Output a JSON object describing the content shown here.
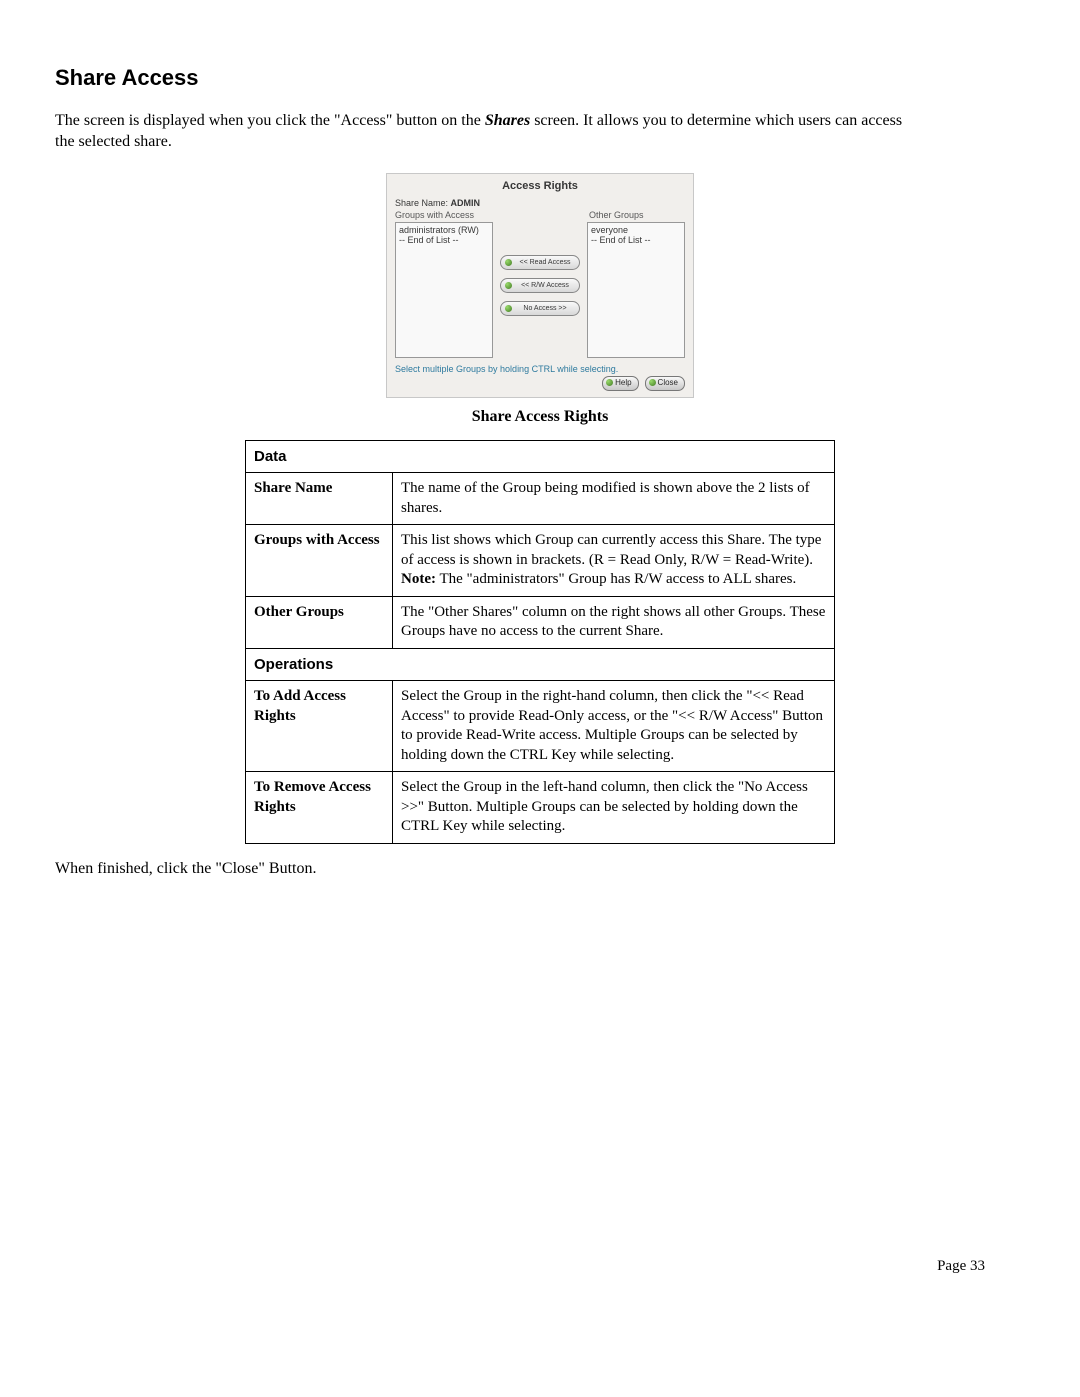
{
  "heading": "Share Access",
  "intro_a": "The screen is displayed when you click the \"Access\" button on the ",
  "intro_b": "Shares",
  "intro_c": " screen. It allows you to determine which users can access the selected share.",
  "dialog": {
    "title": "Access Rights",
    "share_label": "Share Name:",
    "share_value": "ADMIN",
    "left_label": "Groups with Access",
    "right_label": "Other Groups",
    "left_items": [
      "administrators (RW)",
      "-- End of List --"
    ],
    "right_items": [
      "everyone",
      "-- End of List --"
    ],
    "btn_read": "<< Read Access",
    "btn_rw": "<< R/W Access",
    "btn_none": "No Access >>",
    "hint": "Select multiple Groups by holding CTRL while selecting.",
    "btn_help": "Help",
    "btn_close": "Close"
  },
  "caption": "Share Access Rights",
  "table": {
    "section_data": "Data",
    "rows_data": [
      {
        "label": "Share Name",
        "text": "The name of the Group being modified is shown above the 2 lists of shares."
      },
      {
        "label": "Groups with Access",
        "text_a": "This list shows which Group can currently access this Share. The type of access is shown in brackets. (R = Read Only, R/W = Read-Write).",
        "note_b": "Note:",
        "text_b": " The \"administrators\" Group has R/W access to ALL shares."
      },
      {
        "label": "Other Groups",
        "text": "The \"Other Shares\" column on the right shows all other Groups. These Groups have no access to the current Share."
      }
    ],
    "section_ops": "Operations",
    "rows_ops": [
      {
        "label": "To Add Access Rights",
        "text": "Select the Group in the right-hand column, then click the \"<< Read Access\" to provide Read-Only access, or the \"<< R/W Access\" Button to provide Read-Write access. Multiple Groups can be selected by holding down the CTRL Key while selecting."
      },
      {
        "label": "To Remove Access Rights",
        "text": "Select the Group in the left-hand column, then click the \"No Access >>\" Button. Multiple Groups can be selected by holding down the CTRL Key while selecting."
      }
    ]
  },
  "afternote": "When finished, click the \"Close\" Button.",
  "page_number": "Page 33"
}
